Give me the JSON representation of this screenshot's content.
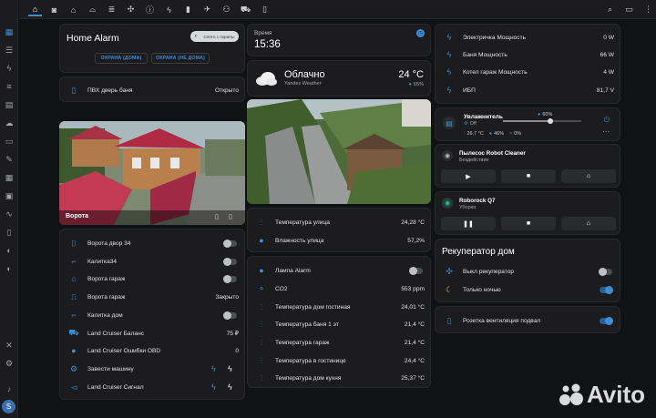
{
  "sidebar": {
    "items": [
      "dashboard-icon",
      "contacts-icon",
      "energy-icon",
      "list-icon",
      "chart-icon",
      "cloud-icon",
      "storage-icon",
      "wrench-icon",
      "grid-icon",
      "media-icon",
      "pulse-icon",
      "terminal-icon",
      "compass-icon",
      "compass-icon"
    ],
    "bottom": [
      "hammer-icon",
      "gear-icon",
      "bell-icon"
    ],
    "avatar": "S"
  },
  "topbar": {
    "tabs": [
      "home",
      "camera",
      "house",
      "garage",
      "heater",
      "fan",
      "info",
      "bolt",
      "battery",
      "plane",
      "network",
      "car",
      "phone"
    ]
  },
  "alarm": {
    "title": "Home Alarm",
    "status": "Снято с охраны",
    "arm_home": "ОХРАНА (ДОМА)",
    "arm_away": "ОХРАНА (НЕ ДОМА)"
  },
  "pvh": {
    "label": "ПВХ дверь баня",
    "value": "Открыто"
  },
  "camera1": {
    "label": "Ворота"
  },
  "entities_left": [
    {
      "icon": "gate-icon",
      "label": "Ворота двор 34",
      "type": "toggle",
      "on": false
    },
    {
      "icon": "wicket-icon",
      "label": "Калитка34",
      "type": "toggle",
      "on": false
    },
    {
      "icon": "garage-icon",
      "label": "Ворота гараж",
      "type": "toggle",
      "on": false
    },
    {
      "icon": "garage-door-icon",
      "label": "Ворота гараж",
      "type": "value",
      "value": "Закрыто"
    },
    {
      "icon": "wicket-icon",
      "label": "Калитка дом",
      "type": "toggle",
      "on": false
    },
    {
      "icon": "car-icon",
      "label": "Land Cruiser Баланс",
      "type": "value",
      "value": "75 ₽"
    },
    {
      "icon": "globe-icon",
      "label": "Land Cruiser Ошибки OBD",
      "type": "value",
      "value": "0"
    },
    {
      "icon": "engine-icon",
      "label": "Завести машину",
      "type": "bolts"
    },
    {
      "icon": "horn-icon",
      "label": "Land Cruiser Сигнал",
      "type": "bolts"
    }
  ],
  "time": {
    "label": "Время",
    "value": "15:36"
  },
  "weather": {
    "condition": "Облачно",
    "source": "Yandex Weather",
    "temperature": "24 °C",
    "humidity": "55%"
  },
  "sensors_street": [
    {
      "label": "Температура улица",
      "value": "24,28 °C"
    },
    {
      "label": "Влажность улица",
      "value": "57,2%"
    }
  ],
  "sensors_home": [
    {
      "icon": "lamp-icon",
      "label": "Лампа Alarm",
      "type": "toggle"
    },
    {
      "icon": "molecule-icon",
      "label": "CO2",
      "value": "553 ppm"
    },
    {
      "icon": "thermometer-icon",
      "label": "Температура дом гостиная",
      "value": "24,01 °C"
    },
    {
      "icon": "thermometer-icon",
      "label": "Температура баня 1 эт",
      "value": "21,4 °C"
    },
    {
      "icon": "thermometer-icon",
      "label": "Температура гараж",
      "value": "21,4 °C"
    },
    {
      "icon": "thermometer-icon",
      "label": "Температура в гостинице",
      "value": "24,4 °C"
    },
    {
      "icon": "thermometer-icon",
      "label": "Температура дом кухня",
      "value": "25,37 °C"
    }
  ],
  "power": [
    {
      "label": "Электричка Мощность",
      "value": "0 W"
    },
    {
      "label": "Баня Мощность",
      "value": "66 W"
    },
    {
      "label": "Котел гараж Мощность",
      "value": "4 W"
    },
    {
      "label": "ИБП",
      "value": "81,7 V"
    }
  ],
  "humidifier": {
    "title": "Увлажнитель",
    "state": "Off",
    "target": "60%",
    "target_fraction": 0.6,
    "temp": "26,7 °C",
    "humidity": "46%",
    "water": "0%"
  },
  "vacuum1": {
    "title": "Пылесос Robot Cleaner",
    "status": "Бездействие"
  },
  "vacuum2": {
    "title": "Roborock Q7",
    "status": "Уборка"
  },
  "recuperator": {
    "title": "Рекуператор дом",
    "rows": [
      {
        "label": "Выкл рекуператор",
        "on": false
      },
      {
        "label": "Только ночью",
        "on": true
      }
    ]
  },
  "socket": {
    "label": "Розетка вентиляция подвал",
    "on": true
  },
  "watermark": "Avito",
  "colors": {
    "accent": "#3b8fd8",
    "card": "#1c1c1e",
    "background": "#111214"
  }
}
